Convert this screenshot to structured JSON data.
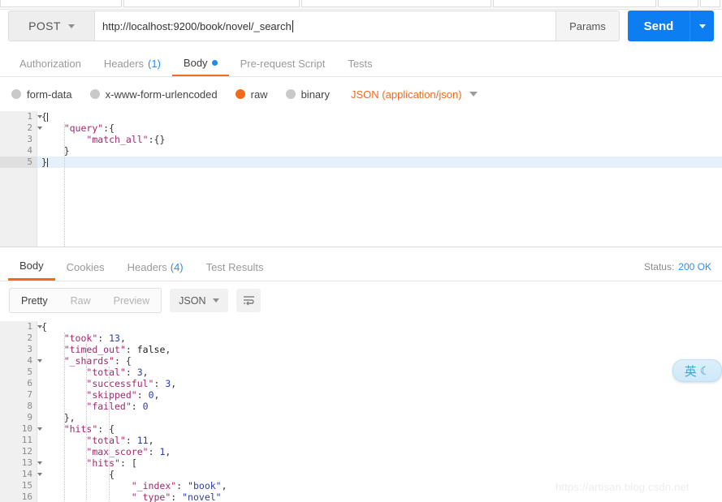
{
  "top_strip": {
    "chips": [
      18,
      26,
      28,
      24,
      6,
      3
    ]
  },
  "request": {
    "method": "POST",
    "url": "http://localhost:9200/book/novel/_search",
    "params_label": "Params",
    "send_label": "Send",
    "tabs": [
      {
        "label": "Authorization",
        "badge": "",
        "active": false,
        "dot": false
      },
      {
        "label": "Headers",
        "badge": "(1)",
        "active": false,
        "dot": false
      },
      {
        "label": "Body",
        "badge": "",
        "active": true,
        "dot": true
      },
      {
        "label": "Pre-request Script",
        "badge": "",
        "active": false,
        "dot": false
      },
      {
        "label": "Tests",
        "badge": "",
        "active": false,
        "dot": false
      }
    ],
    "body_types": [
      {
        "label": "form-data",
        "selected": false
      },
      {
        "label": "x-www-form-urlencoded",
        "selected": false
      },
      {
        "label": "raw",
        "selected": true
      },
      {
        "label": "binary",
        "selected": false
      }
    ],
    "content_type": "JSON (application/json)",
    "editor": {
      "lines": [
        {
          "no": "1",
          "fold": true,
          "current": false,
          "text": "{"
        },
        {
          "no": "2",
          "fold": true,
          "current": false,
          "text": "    \"query\":{"
        },
        {
          "no": "3",
          "fold": false,
          "current": false,
          "text": "        \"match_all\":{}"
        },
        {
          "no": "4",
          "fold": false,
          "current": false,
          "text": "    }"
        },
        {
          "no": "5",
          "fold": false,
          "current": true,
          "text": "}"
        }
      ]
    }
  },
  "response": {
    "tabs": [
      {
        "label": "Body",
        "badge": "",
        "active": true
      },
      {
        "label": "Cookies",
        "badge": "",
        "active": false
      },
      {
        "label": "Headers",
        "badge": "(4)",
        "active": false
      },
      {
        "label": "Test Results",
        "badge": "",
        "active": false
      }
    ],
    "status_label": "Status:",
    "status_value": "200 OK",
    "view_modes": [
      {
        "label": "Pretty",
        "active": true
      },
      {
        "label": "Raw",
        "active": false
      },
      {
        "label": "Preview",
        "active": false
      }
    ],
    "format": "JSON",
    "wrap_icon": "word-wrap-icon",
    "editor": {
      "lines": [
        {
          "no": "1",
          "fold": true,
          "text": "{"
        },
        {
          "no": "2",
          "fold": false,
          "text": "    \"took\": 13,"
        },
        {
          "no": "3",
          "fold": false,
          "text": "    \"timed_out\": false,"
        },
        {
          "no": "4",
          "fold": true,
          "text": "    \"_shards\": {"
        },
        {
          "no": "5",
          "fold": false,
          "text": "        \"total\": 3,"
        },
        {
          "no": "6",
          "fold": false,
          "text": "        \"successful\": 3,"
        },
        {
          "no": "7",
          "fold": false,
          "text": "        \"skipped\": 0,"
        },
        {
          "no": "8",
          "fold": false,
          "text": "        \"failed\": 0"
        },
        {
          "no": "9",
          "fold": false,
          "text": "    },"
        },
        {
          "no": "10",
          "fold": true,
          "text": "    \"hits\": {"
        },
        {
          "no": "11",
          "fold": false,
          "text": "        \"total\": 11,"
        },
        {
          "no": "12",
          "fold": false,
          "text": "        \"max_score\": 1,"
        },
        {
          "no": "13",
          "fold": true,
          "text": "        \"hits\": ["
        },
        {
          "no": "14",
          "fold": true,
          "text": "            {"
        },
        {
          "no": "15",
          "fold": false,
          "text": "                \"_index\": \"book\","
        },
        {
          "no": "16",
          "fold": false,
          "text": "                \"_type\": \"novel\""
        }
      ]
    }
  },
  "overlays": {
    "ime_label": "英",
    "ime_icon": "moon-icon",
    "watermark": "https://artisan.blog.csdn.net"
  },
  "colors": {
    "accent": "#f26b1d",
    "send_blue": "#0d7ef2",
    "status_blue": "#2c8ded",
    "json_orange": "#f26b1d"
  }
}
